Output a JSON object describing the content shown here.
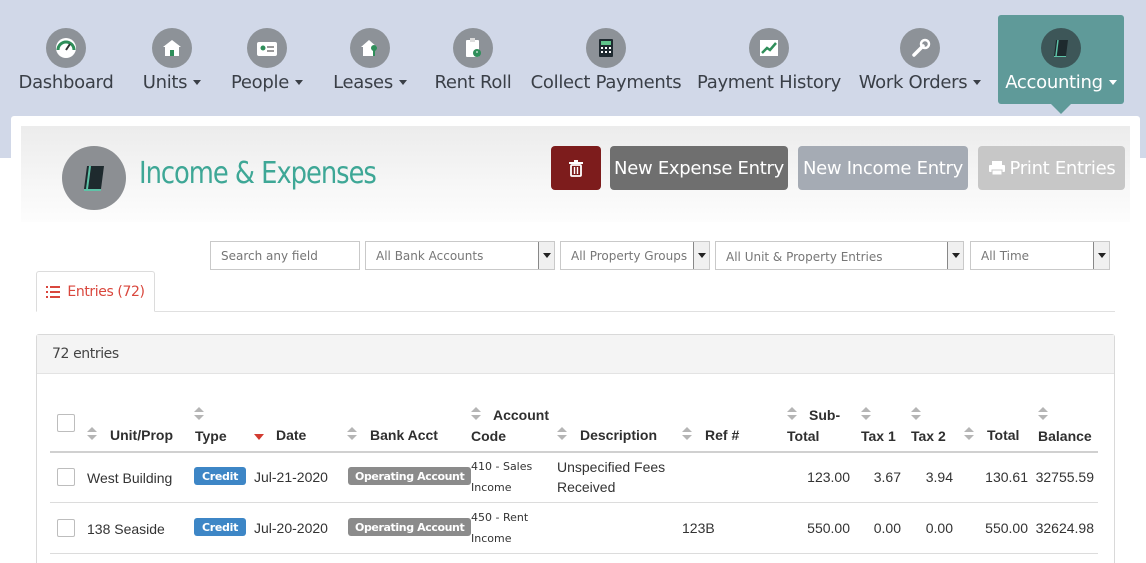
{
  "nav": {
    "items": [
      {
        "label": "Dashboard",
        "icon": "gauge-icon",
        "dropdown": false
      },
      {
        "label": "Units",
        "icon": "house-icon",
        "dropdown": true
      },
      {
        "label": "People",
        "icon": "id-card-icon",
        "dropdown": true
      },
      {
        "label": "Leases",
        "icon": "house-key-icon",
        "dropdown": true
      },
      {
        "label": "Rent Roll",
        "icon": "clipboard-clock-icon",
        "dropdown": false
      },
      {
        "label": "Collect Payments",
        "icon": "calculator-icon",
        "dropdown": false
      },
      {
        "label": "Payment History",
        "icon": "line-chart-icon",
        "dropdown": false
      },
      {
        "label": "Work Orders",
        "icon": "wrench-icon",
        "dropdown": true
      },
      {
        "label": "Accounting",
        "icon": "ledger-book-icon",
        "dropdown": true,
        "active": true
      }
    ]
  },
  "page": {
    "title": "Income & Expenses",
    "icon": "ledger-book-icon"
  },
  "toolbar": {
    "delete_icon": "trash-icon",
    "new_expense_label": "New Expense Entry",
    "new_income_label": "New Income Entry",
    "print_label": "Print Entries",
    "print_icon": "printer-icon"
  },
  "filters": {
    "search_placeholder": "Search any field",
    "bank_accounts": "All Bank Accounts",
    "property_groups": "All Property Groups",
    "unit_entries": "All Unit & Property Entries",
    "time_range": "All Time"
  },
  "tabs": [
    {
      "label": "Entries (72)",
      "icon": "list-icon",
      "active": true
    }
  ],
  "entries": {
    "count_label": "72 entries",
    "columns": {
      "unit": "Unit/Prop",
      "type": "Type",
      "date": "Date",
      "bank": "Bank Acct",
      "account_line1": "Account",
      "account_line2": "Code",
      "description": "Description",
      "ref": "Ref #",
      "subtotal_line1": "Sub-",
      "subtotal_line2": "Total",
      "tax1": "Tax 1",
      "tax2": "Tax 2",
      "total": "Total",
      "balance": "Balance"
    },
    "rows": [
      {
        "unit": "West Building",
        "type": "Credit",
        "date": "Jul-21-2020",
        "bank": "Operating Account",
        "account_line1": "410 - Sales",
        "account_line2": "Income",
        "description_line1": "Unspecified Fees",
        "description_line2": "Received",
        "ref": "",
        "subtotal": "123.00",
        "tax1": "3.67",
        "tax2": "3.94",
        "total": "130.61",
        "balance": "32755.59"
      },
      {
        "unit": "138 Seaside",
        "type": "Credit",
        "date": "Jul-20-2020",
        "bank": "Operating Account",
        "account_line1": "450 - Rent",
        "account_line2": "Income",
        "description_line1": "",
        "description_line2": "",
        "ref": "123B",
        "subtotal": "550.00",
        "tax1": "0.00",
        "tax2": "0.00",
        "total": "550.00",
        "balance": "32624.98"
      }
    ]
  },
  "colors": {
    "nav_bg": "#d1d8e8",
    "nav_active": "#5f9a99",
    "title_teal": "#3ea796",
    "delete_red": "#7d1c1c",
    "credit_blue": "#3d86c6",
    "sort_active_red": "#d23b30"
  }
}
